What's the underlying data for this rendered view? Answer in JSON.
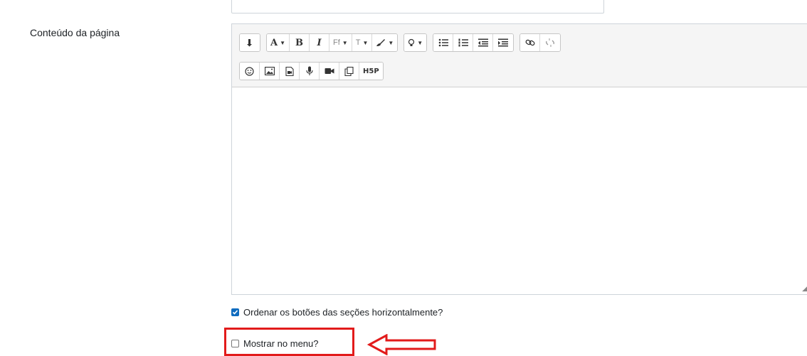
{
  "form": {
    "content_label": "Conteúdo da página",
    "checkbox_order": {
      "label": "Ordenar os botões das seções horizontalmente?",
      "checked": true
    },
    "checkbox_menu": {
      "label": "Mostrar no menu?",
      "checked": false
    }
  },
  "toolbar": {
    "row1": {
      "font_color_label": "A",
      "bold_label": "B",
      "italic_label": "I",
      "font_family_label": "Ff",
      "font_size_label": "T"
    },
    "row2": {
      "h5p_label": "H5P"
    }
  },
  "editor": {
    "content": ""
  },
  "annotation": {
    "highlight_color": "#e21b1b"
  },
  "colors": {
    "accent": "#0f6cbf"
  }
}
